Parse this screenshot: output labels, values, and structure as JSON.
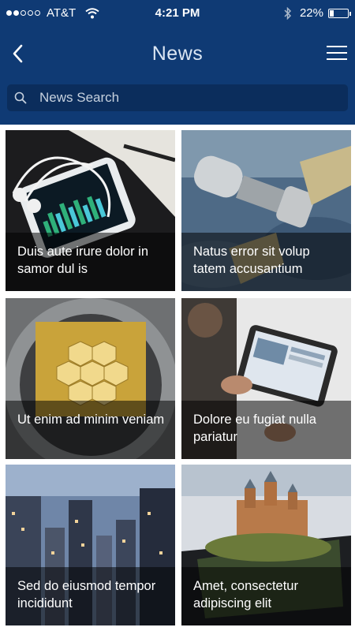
{
  "status_bar": {
    "carrier": "AT&T",
    "time": "4:21 PM",
    "battery_percent": "22%",
    "battery_level": 0.22,
    "signal_bars": 2,
    "icons": [
      "wifi-icon",
      "bluetooth-icon",
      "battery-icon"
    ]
  },
  "header": {
    "title": "News",
    "back_icon": "chevron-left-icon",
    "menu_icon": "hamburger-menu-icon"
  },
  "search": {
    "placeholder": "News Search",
    "value": ""
  },
  "colors": {
    "header_bg": "#0f3a74",
    "search_bg": "#0b2d5c",
    "caption_overlay": "rgba(0,0,0,0.52)"
  },
  "articles": [
    {
      "title": "Duis aute irure dolor in samor dul is",
      "image": "smartphone-with-earphones"
    },
    {
      "title": "Natus error sit volup tatem accusantium",
      "image": "spacecraft-above-earth"
    },
    {
      "title": "Ut enim ad minim veniam",
      "image": "telescope-gold-mirror"
    },
    {
      "title": "Dolore eu fugiat nulla pariatur",
      "image": "man-using-tablet"
    },
    {
      "title": "Sed do eiusmod tempor incididunt",
      "image": "city-skyline-night"
    },
    {
      "title": "Amet, consectetur adipiscing elit",
      "image": "castle-on-phone-screen"
    }
  ]
}
